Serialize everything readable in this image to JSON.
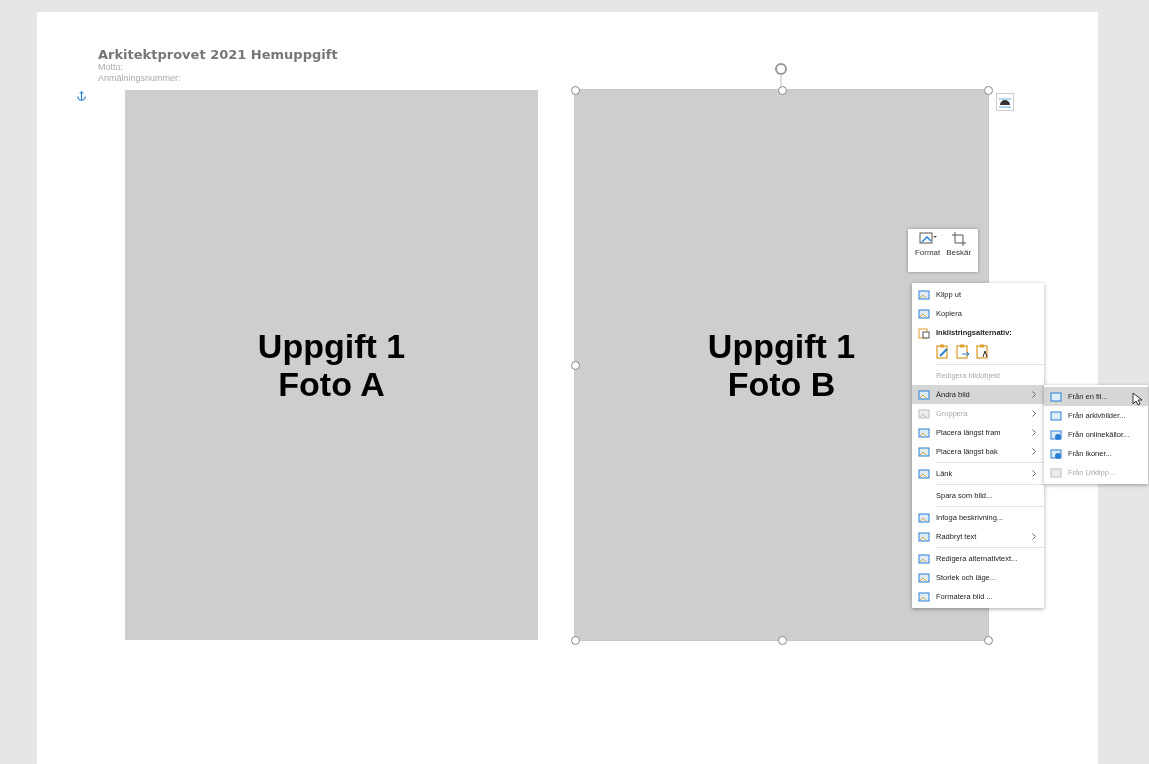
{
  "document": {
    "title": "Arkitektprovet 2021 Hemuppgift",
    "fields": [
      "Motto:",
      "Anmälningsnummer:"
    ]
  },
  "photos": [
    {
      "line1": "Uppgift 1",
      "line2": "Foto A",
      "selected": false
    },
    {
      "line1": "Uppgift 1",
      "line2": "Foto B",
      "selected": true
    }
  ],
  "mini_toolbar": [
    "Format",
    "Beskär"
  ],
  "context_menu": [
    {
      "kind": "item",
      "label": "Klipp ut",
      "disabled": false,
      "selected": false,
      "submenu": false
    },
    {
      "kind": "item",
      "label": "Kopiera",
      "disabled": false,
      "selected": false,
      "submenu": false
    },
    {
      "kind": "heading",
      "label": "Inklistringsalternativ:"
    },
    {
      "kind": "paste-options"
    },
    {
      "kind": "separator"
    },
    {
      "kind": "item",
      "label": "Redigera bildobjekt",
      "disabled": true,
      "selected": false,
      "submenu": false
    },
    {
      "kind": "item",
      "label": "Ändra bild",
      "disabled": false,
      "selected": true,
      "submenu": true
    },
    {
      "kind": "item",
      "label": "Gruppera",
      "disabled": true,
      "selected": false,
      "submenu": true
    },
    {
      "kind": "item",
      "label": "Placera längst fram",
      "disabled": false,
      "selected": false,
      "submenu": true
    },
    {
      "kind": "item",
      "label": "Placera längst bak",
      "disabled": false,
      "selected": false,
      "submenu": true
    },
    {
      "kind": "separator"
    },
    {
      "kind": "item",
      "label": "Länk",
      "disabled": false,
      "selected": false,
      "submenu": true
    },
    {
      "kind": "separator"
    },
    {
      "kind": "item",
      "label": "Spara som bild...",
      "disabled": false,
      "selected": false,
      "submenu": false
    },
    {
      "kind": "separator"
    },
    {
      "kind": "item",
      "label": "Infoga beskrivning...",
      "disabled": false,
      "selected": false,
      "submenu": false
    },
    {
      "kind": "item",
      "label": "Radbryt text",
      "disabled": false,
      "selected": false,
      "submenu": true
    },
    {
      "kind": "separator"
    },
    {
      "kind": "item",
      "label": "Redigera alternativtext...",
      "disabled": false,
      "selected": false,
      "submenu": false
    },
    {
      "kind": "item",
      "label": "Storlek och läge...",
      "disabled": false,
      "selected": false,
      "submenu": false
    },
    {
      "kind": "item",
      "label": "Formatera bild ...",
      "disabled": false,
      "selected": false,
      "submenu": false
    }
  ],
  "submenu": [
    {
      "label": "Från en fil...",
      "disabled": false,
      "selected": true
    },
    {
      "label": "Från arkivbilder...",
      "disabled": false,
      "selected": false
    },
    {
      "label": "Från onlinekällor...",
      "disabled": false,
      "selected": false
    },
    {
      "label": "Från ikoner...",
      "disabled": false,
      "selected": false
    },
    {
      "label": "Från Urklipp...",
      "disabled": true,
      "selected": false
    }
  ]
}
